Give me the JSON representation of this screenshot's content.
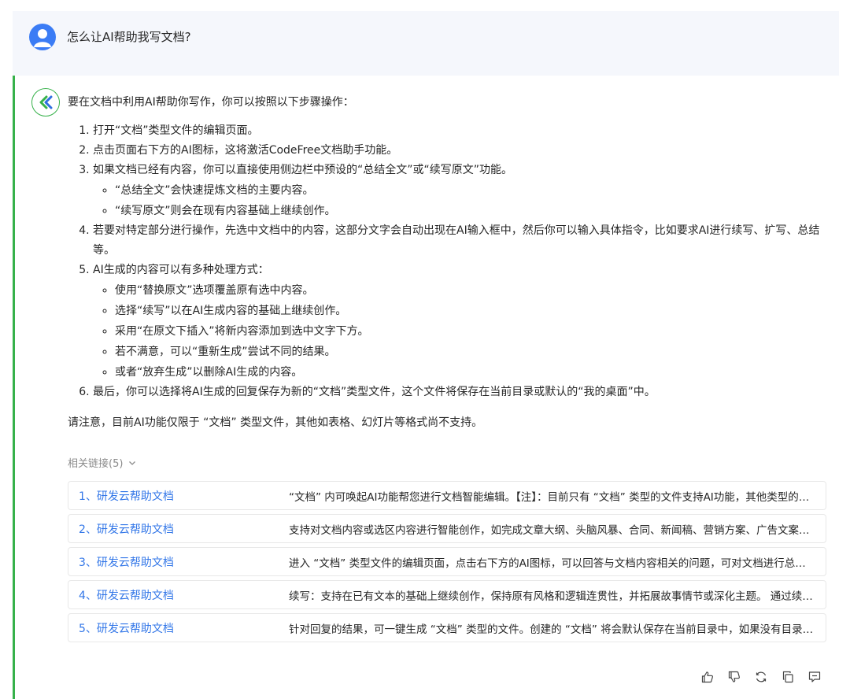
{
  "user": {
    "question": "怎么让AI帮助我写文档?"
  },
  "answer": {
    "intro": "要在文档中利用AI帮助你写作，你可以按照以下步骤操作：",
    "steps": [
      {
        "text": "打开“文档”类型文件的编辑页面。"
      },
      {
        "text": "点击页面右下方的AI图标，这将激活CodeFree文档助手功能。"
      },
      {
        "text": "如果文档已经有内容，你可以直接使用侧边栏中预设的“总结全文”或“续写原文”功能。",
        "sub": [
          "“总结全文”会快速提炼文档的主要内容。",
          "“续写原文”则会在现有内容基础上继续创作。"
        ]
      },
      {
        "text": "若要对特定部分进行操作，先选中文档中的内容，这部分文字会自动出现在AI输入框中，然后你可以输入具体指令，比如要求AI进行续写、扩写、总结等。"
      },
      {
        "text": "AI生成的内容可以有多种处理方式：",
        "sub": [
          "使用“替换原文”选项覆盖原有选中内容。",
          "选择“续写”以在AI生成内容的基础上继续创作。",
          "采用“在原文下插入”将新内容添加到选中文字下方。",
          "若不满意，可以“重新生成”尝试不同的结果。",
          "或者“放弃生成”以删除AI生成的内容。"
        ]
      },
      {
        "text": "最后，你可以选择将AI生成的回复保存为新的“文档”类型文件，这个文件将保存在当前目录或默认的“我的桌面”中。"
      }
    ],
    "note": "请注意，目前AI功能仅限于 “文档” 类型文件，其他如表格、幻灯片等格式尚不支持。"
  },
  "related": {
    "header": "相关链接(5)",
    "items": [
      {
        "title": "1、研发云帮助文档",
        "desc": "“文档” 内可唤起AI功能帮您进行文档智能编辑。【注】：目前只有 “文档” 类型的文件支持AI功能，其他类型的文件暂不支持。"
      },
      {
        "title": "2、研发云帮助文档",
        "desc": "支持对文档内容或选区内容进行智能创作，如完成文章大纲、头脑风暴、合同、新闻稿、营销方案、广告文案等。"
      },
      {
        "title": "3、研发云帮助文档",
        "desc": "进入 “文档” 类型文件的编辑页面，点击右下方的AI图标，可以回答与文档内容相关的问题，可对文档进行总结。"
      },
      {
        "title": "4、研发云帮助文档",
        "desc": "续写：支持在已有文本的基础上继续创作，保持原有风格和逻辑连贯性，并拓展故事情节或深化主题。 通过续写功能。"
      },
      {
        "title": "5、研发云帮助文档",
        "desc": "针对回复的结果，可一键生成 “文档” 类型的文件。创建的 “文档” 将会默认保存在当前目录中，如果没有目录则保存在桌面。"
      }
    ]
  },
  "colors": {
    "accent_blue": "#3377e8",
    "accent_green": "#36b14a",
    "user_bg": "#f5f7fc"
  },
  "actions": [
    "thumbs-up-icon",
    "thumbs-down-icon",
    "regenerate-icon",
    "copy-icon",
    "share-icon"
  ]
}
